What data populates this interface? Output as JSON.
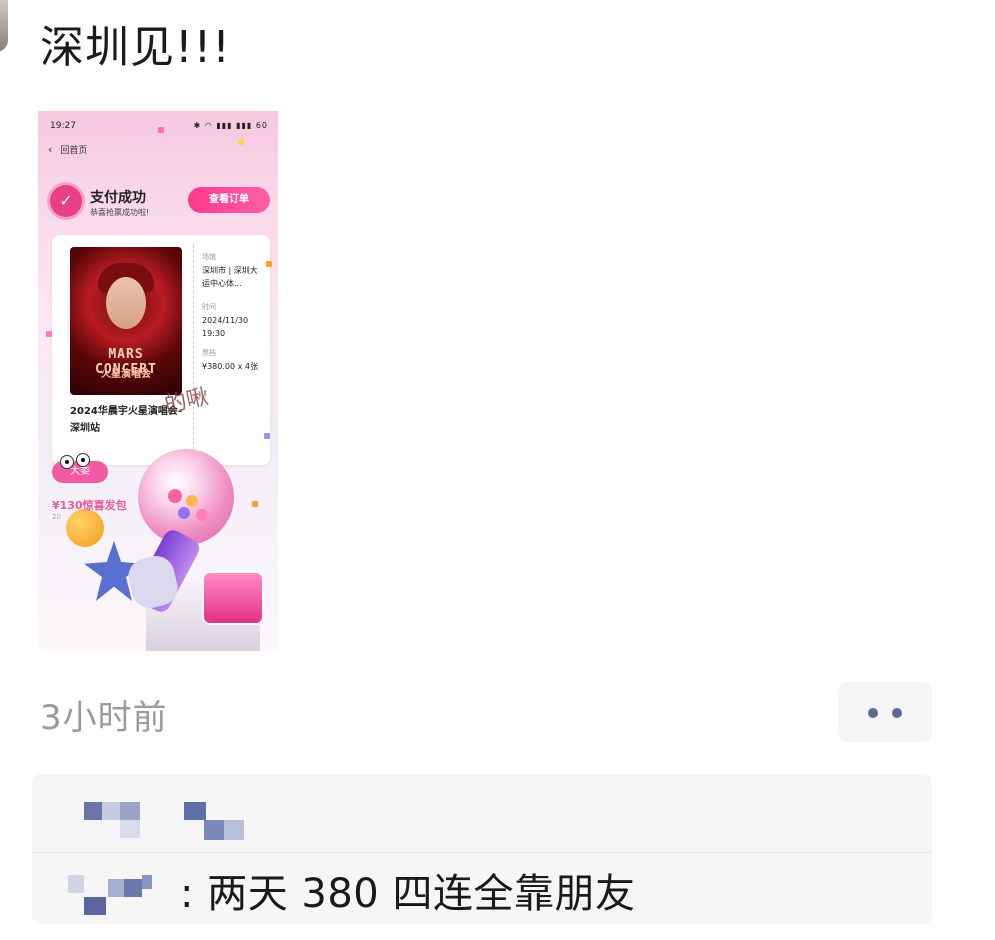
{
  "post": {
    "text": "深圳见!!!",
    "time": "3小时前"
  },
  "screenshot": {
    "status_time": "19:27",
    "status_icons": "✱ ◠ ▮▮▮ ▮▮▮ 60",
    "back_label": "回首页",
    "pay_title": "支付成功",
    "pay_subtitle": "恭喜抢票成功啦!",
    "view_order_label": "查看订单",
    "poster_line1": "MARS CONCERT",
    "poster_line2": "火星演唱会",
    "concert_title": "2024华晨宇火星演唱会-深圳站",
    "venue_label": "场馆",
    "venue_value": "深圳市 | 深圳大运中心体...",
    "time_label": "时间",
    "time_value": "2024/11/30 19:30",
    "ticket_label": "票档",
    "ticket_value": "¥380.00 x 4张",
    "handwriting": "的啾",
    "sticker_label": "大委",
    "promo_price": "¥130惊喜发包",
    "promo_sub": "20"
  },
  "comments": {
    "items": [
      {
        "text": ": 两天 380 四连全靠朋友"
      }
    ]
  },
  "colors": {
    "accent_pink": "#ff3a8c",
    "time_gray": "#9b9b9b",
    "dot_blue": "#5b6a92",
    "box_bg": "#f6f6f6"
  },
  "icons": {
    "more": "more-dots-icon",
    "pay_success": "check-badge-icon",
    "back": "chevron-left-icon"
  }
}
